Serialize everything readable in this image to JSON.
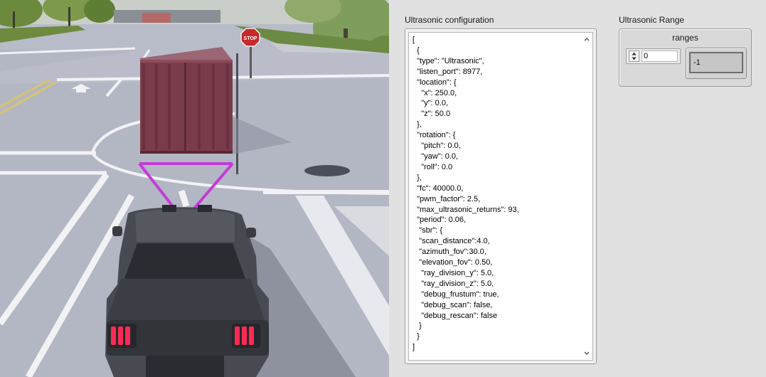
{
  "scene": {
    "stop_sign": "STOP",
    "colors": {
      "sky": "#c9cfc8",
      "road": "#b5b9c6",
      "container": "#7a3c4a",
      "frustum": "#c43ad8",
      "car": "#474a51",
      "tail_light": "#ff2a55"
    }
  },
  "config_section": {
    "title": "Ultrasonic configuration",
    "text": "[\n  {\n  \"type\": \"Ultrasonic\",\n  \"listen_port\": 8977,\n  \"location\": {\n    \"x\": 250.0,\n    \"y\": 0.0,\n    \"z\": 50.0\n  },\n  \"rotation\": {\n    \"pitch\": 0.0,\n    \"yaw\": 0.0,\n    \"roll\": 0.0\n  },\n  \"fc\": 40000.0,\n  \"pwm_factor\": 2.5,\n  \"max_ultrasonic_returns\": 93,\n  \"period\": 0.06,\n   \"sbr\": {\n   \"scan_distance\":4.0,\n   \"azimuth_fov\":30.0,\n   \"elevation_fov\": 0.50,\n    \"ray_division_y\": 5.0,\n    \"ray_division_z\": 5.0,\n    \"debug_frustum\": true,\n    \"debug_scan\": false,\n    \"debug_rescan\": false\n   }\n  }\n]",
    "scroll_up": "up-arrow-icon",
    "scroll_down": "down-arrow-icon"
  },
  "range_section": {
    "title": "Ultrasonic Range",
    "array_label": "ranges",
    "index_value": "0",
    "value": "-1",
    "spin_up": "up-arrow-icon",
    "spin_down": "down-arrow-icon"
  }
}
